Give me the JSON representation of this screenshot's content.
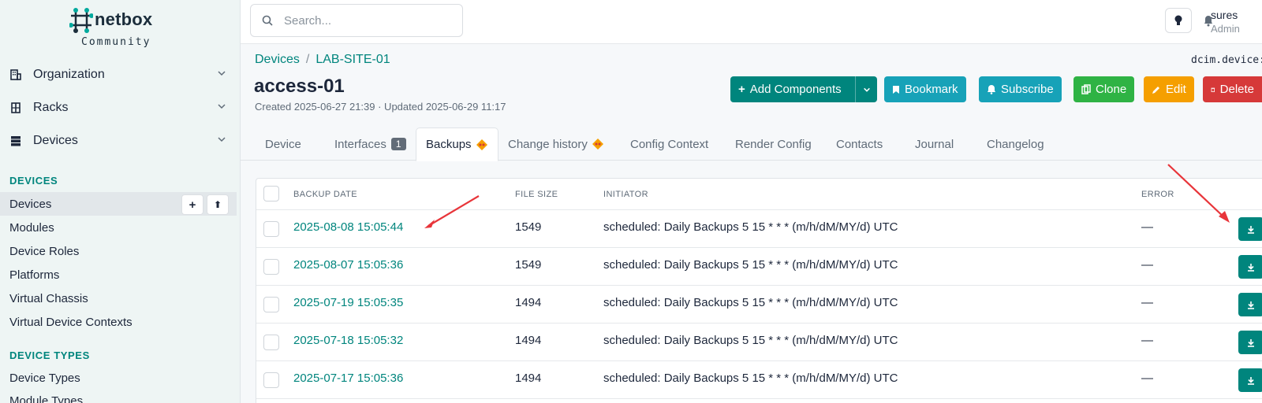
{
  "app": {
    "name": "netbox",
    "edition": "Community"
  },
  "sidebar": {
    "groups": [
      {
        "label": "Organization"
      },
      {
        "label": "Racks"
      },
      {
        "label": "Devices"
      }
    ],
    "sections": [
      {
        "heading": "DEVICES",
        "items": [
          "Devices",
          "Modules",
          "Device Roles",
          "Platforms",
          "Virtual Chassis",
          "Virtual Device Contexts"
        ]
      },
      {
        "heading": "DEVICE TYPES",
        "items": [
          "Device Types",
          "Module Types"
        ]
      }
    ],
    "add_label": "+",
    "import_label": "⬆"
  },
  "search": {
    "placeholder": "Search..."
  },
  "user": {
    "name": "sures",
    "role": "Admin"
  },
  "breadcrumb": [
    "Devices",
    "LAB-SITE-01"
  ],
  "object_name": "dcim.device:",
  "page": {
    "title": "access-01",
    "meta": "Created 2025-06-27 21:39 · Updated 2025-06-29 11:17"
  },
  "actions": {
    "add_components": "Add Components",
    "bookmark": "Bookmark",
    "subscribe": "Subscribe",
    "clone": "Clone",
    "edit": "Edit",
    "delete": "Delete"
  },
  "colors": {
    "primary": "#00857d",
    "cyan": "#17a2b8",
    "green": "#2fb344",
    "orange": "#f59f00",
    "red": "#d63939"
  },
  "tabs": [
    {
      "label": "Device"
    },
    {
      "label": "Interfaces",
      "badge": "1"
    },
    {
      "label": "Backups",
      "active": true
    },
    {
      "label": "Change history"
    },
    {
      "label": "Config Context"
    },
    {
      "label": "Render Config"
    },
    {
      "label": "Contacts"
    },
    {
      "label": "Journal"
    },
    {
      "label": "Changelog"
    }
  ],
  "table": {
    "columns": [
      "BACKUP DATE",
      "FILE SIZE",
      "INITIATOR",
      "ERROR"
    ],
    "rows": [
      {
        "date": "2025-08-08 15:05:44",
        "size": "1549",
        "initiator": "scheduled: Daily Backups 5 15 * * * (m/h/dM/MY/d) UTC",
        "error": "—"
      },
      {
        "date": "2025-08-07 15:05:36",
        "size": "1549",
        "initiator": "scheduled: Daily Backups 5 15 * * * (m/h/dM/MY/d) UTC",
        "error": "—"
      },
      {
        "date": "2025-07-19 15:05:35",
        "size": "1494",
        "initiator": "scheduled: Daily Backups 5 15 * * * (m/h/dM/MY/d) UTC",
        "error": "—"
      },
      {
        "date": "2025-07-18 15:05:32",
        "size": "1494",
        "initiator": "scheduled: Daily Backups 5 15 * * * (m/h/dM/MY/d) UTC",
        "error": "—"
      },
      {
        "date": "2025-07-17 15:05:36",
        "size": "1494",
        "initiator": "scheduled: Daily Backups 5 15 * * * (m/h/dM/MY/d) UTC",
        "error": "—"
      }
    ]
  }
}
